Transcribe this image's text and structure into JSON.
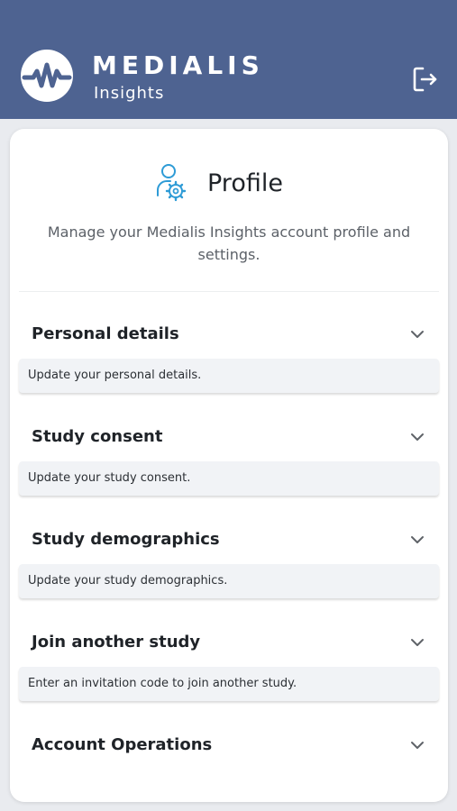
{
  "header": {
    "brand_name": "MEDIALIS",
    "brand_sub": "Insights",
    "logo_icon": "heartbeat-icon",
    "logout_icon": "logout-icon"
  },
  "profile": {
    "icon": "user-gear-icon",
    "title": "Profile",
    "description": "Manage your Medialis Insights account profile and settings."
  },
  "sections": [
    {
      "title": "Personal details",
      "description": "Update your personal details."
    },
    {
      "title": "Study consent",
      "description": "Update your study consent."
    },
    {
      "title": "Study demographics",
      "description": "Update your study demographics."
    },
    {
      "title": "Join another study",
      "description": "Enter an invitation code to join another study."
    },
    {
      "title": "Account Operations"
    }
  ],
  "colors": {
    "header_bg": "#4e6391",
    "accent_icon": "#2e9bd6",
    "card_bg": "#ffffff",
    "section_body_bg": "#f1f3f6"
  }
}
